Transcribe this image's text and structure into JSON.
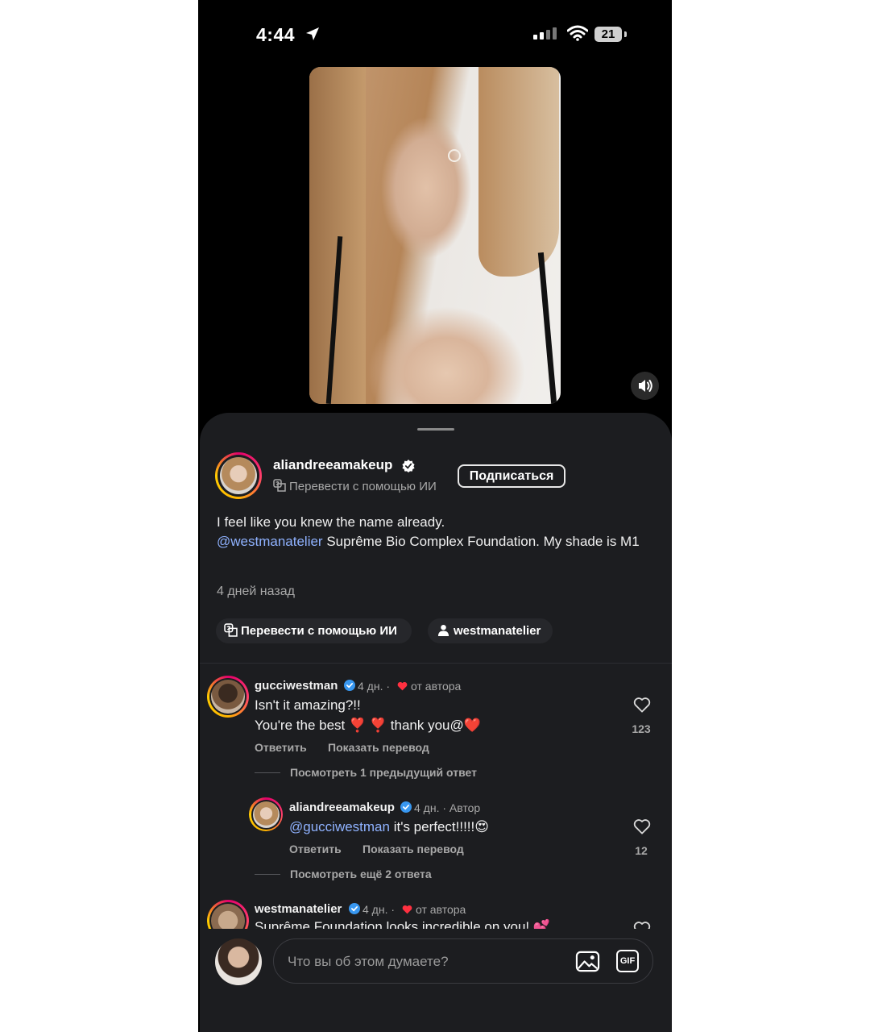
{
  "status_bar": {
    "time": "4:44",
    "battery": "21"
  },
  "post": {
    "author": "aliandreeamakeup",
    "translate_label": "Перевести с помощью ИИ",
    "follow_label": "Подписаться",
    "caption_line1": "I feel like you knew the name already.",
    "caption_mention": "@westmanatelier",
    "caption_rest": " Suprême Bio Complex Foundation. My shade is M1",
    "posted_ago": "4 дней назад",
    "chips": {
      "translate": "Перевести с помощью ИИ",
      "tagged_user": "westmanatelier"
    }
  },
  "comments": [
    {
      "user": "gucciwestman",
      "time": "4 дн. ·",
      "badge": "от автора",
      "line1": "Isn't it amazing?!!",
      "line2": "You're the best ❣️ ❣️ thank you@❤️",
      "reply_label": "Ответить",
      "translate_label": "Показать перевод",
      "likes": "123",
      "view_replies": "Посмотреть 1 предыдущий ответ"
    },
    {
      "user": "aliandreeamakeup",
      "time": "4 дн. · Автор",
      "mention": "@gucciwestman",
      "text": " it's perfect!!!!!😍",
      "reply_label": "Ответить",
      "translate_label": "Показать перевод",
      "likes": "12",
      "view_replies": "Посмотреть ещё 2 ответа"
    },
    {
      "user": "westmanatelier",
      "time": "4 дн. ·",
      "badge": "от автора",
      "text": "Suprême Foundation looks incredible on you! 💕"
    }
  ],
  "composer": {
    "placeholder": "Что вы об этом думаете?",
    "gif_label": "GIF"
  },
  "colors": {
    "background": "#000000",
    "sheet": "#1c1d20",
    "mention": "#8fb2ff",
    "verified": "#3897f0",
    "heart_red": "#ff3040"
  },
  "icons": [
    "location-arrow-icon",
    "signal-icon",
    "wifi-icon",
    "battery-icon",
    "sound-icon",
    "verified-icon",
    "translate-icon",
    "user-icon",
    "heart-icon",
    "image-icon",
    "gif-icon"
  ]
}
